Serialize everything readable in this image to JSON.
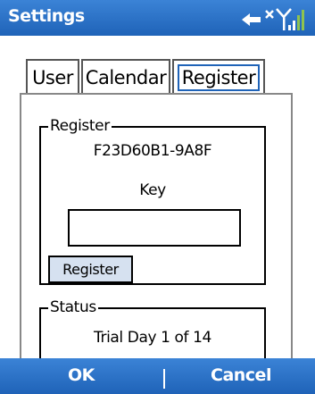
{
  "titlebar": {
    "title": "Settings",
    "icons": [
      "connection-icon",
      "signal-icon"
    ]
  },
  "tabs": [
    {
      "label": "User",
      "selected": false
    },
    {
      "label": "Calendar",
      "selected": false
    },
    {
      "label": "Register",
      "selected": true
    }
  ],
  "register_group": {
    "legend": "Register",
    "device_id": "F23D60B1-9A8F",
    "key_label": "Key",
    "key_value": "",
    "button_label": "Register"
  },
  "status_group": {
    "legend": "Status",
    "text": "Trial Day 1 of 14"
  },
  "softkeys": {
    "left": "OK",
    "right": "Cancel"
  },
  "colors": {
    "bar": "#2a72c8",
    "button_bg": "#d6e1f0",
    "selection": "#1f63b8"
  }
}
